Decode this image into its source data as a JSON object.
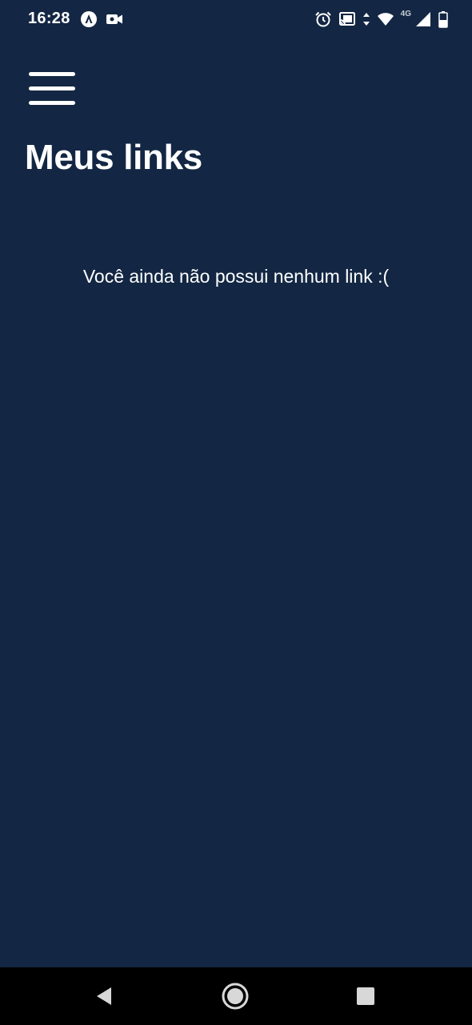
{
  "status_bar": {
    "time": "16:28",
    "network": "4G",
    "left_icons": [
      "app-notification-icon",
      "video-camera-icon"
    ],
    "right_icons": [
      "alarm-icon",
      "cast-icon",
      "data-transfer-icon",
      "wifi-icon",
      "cell-signal-icon",
      "battery-icon"
    ]
  },
  "header": {
    "menu_icon": "hamburger-menu-icon",
    "title": "Meus links"
  },
  "main": {
    "empty_message": "Você ainda não possui nenhum link :("
  },
  "nav_bar": {
    "buttons": [
      "back-icon",
      "home-icon",
      "recents-icon"
    ]
  },
  "colors": {
    "background": "#132744",
    "text": "#ffffff",
    "nav_background": "#000000"
  }
}
